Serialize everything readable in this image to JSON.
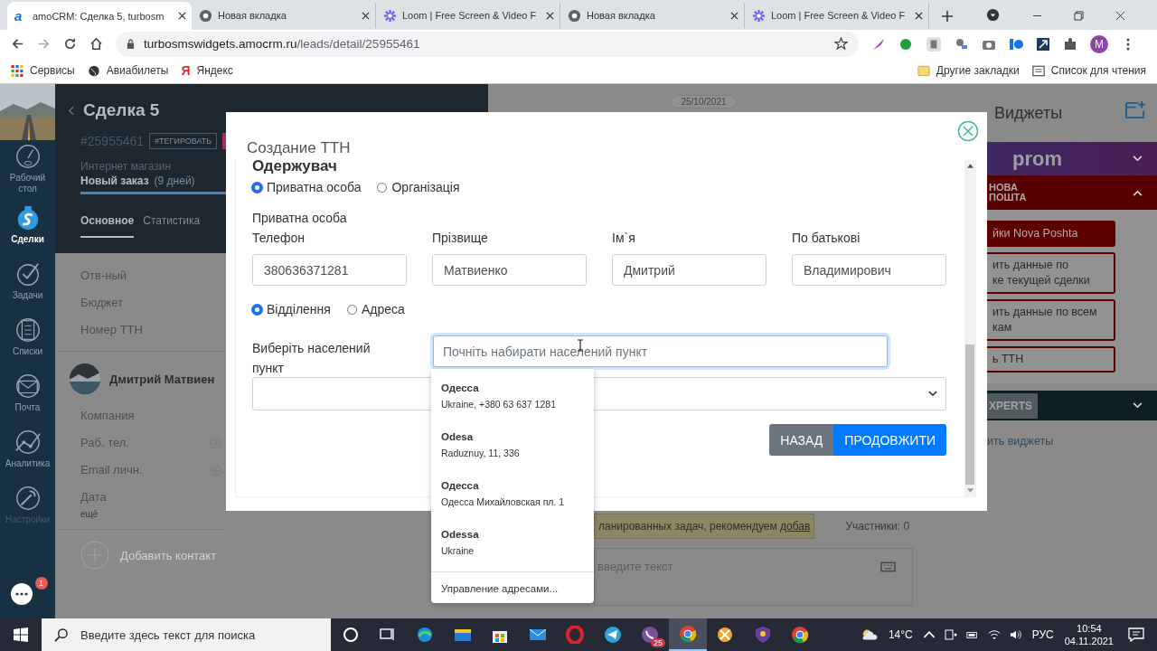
{
  "browser": {
    "tabs": [
      {
        "title": "amoCRM: Сделка 5, turbosm",
        "kind": "amo",
        "glyph": "a",
        "selected": true
      },
      {
        "title": "Новая вкладка",
        "kind": "chrome",
        "selected": false
      },
      {
        "title": "Loom | Free Screen & Video F",
        "kind": "loom",
        "selected": false
      },
      {
        "title": "Новая вкладка",
        "kind": "chrome",
        "selected": false
      },
      {
        "title": "Loom | Free Screen & Video F",
        "kind": "loom",
        "selected": false
      }
    ],
    "url_host": "turbosmswidgets.amocrm.ru",
    "url_path": "/leads/detail/25955461",
    "profile_initial": "M",
    "bookmarks": [
      {
        "label": "Сервисы",
        "kind": "apps"
      },
      {
        "label": "Авиабилеты",
        "kind": "globe"
      },
      {
        "label": "Яндекс",
        "kind": "yandex",
        "glyph": "Я"
      }
    ],
    "bookmarks_right": [
      {
        "label": "Другие закладки",
        "kind": "folder"
      },
      {
        "label": "Список для чтения",
        "kind": "list"
      }
    ]
  },
  "nav": {
    "items": [
      {
        "label": "Рабочий стол",
        "kind": "dashboard",
        "selected": false
      },
      {
        "label": "Сделки",
        "kind": "deals",
        "selected": true
      },
      {
        "label": "Задачи",
        "kind": "tasks",
        "selected": false
      },
      {
        "label": "Списки",
        "kind": "lists",
        "selected": false
      },
      {
        "label": "Почта",
        "kind": "mail",
        "selected": false
      },
      {
        "label": "Аналитика",
        "kind": "analytics",
        "selected": false
      },
      {
        "label": "Настройки",
        "kind": "settings",
        "selected": false
      }
    ],
    "chat_badge": "1"
  },
  "deal": {
    "title": "Сделка 5",
    "id": "#25955461",
    "tag": "#ТЕГИРОВАТЬ",
    "pipeline": "Интернет магазин",
    "stage": "Новый заказ",
    "stage_age": "(9 дней)",
    "level": 0.4,
    "tabs": [
      {
        "label": "Основное",
        "selected": true
      },
      {
        "label": "Статистика",
        "selected": false
      }
    ],
    "fields": [
      "Отв-ный",
      "Бюджет",
      "Номер ТТН"
    ],
    "contact": {
      "name": "Дмитрий Матвиен",
      "fields": [
        {
          "label": "Компания",
          "addable": false
        },
        {
          "label": "Раб. тел.",
          "addable": true
        },
        {
          "label": "Email личн.",
          "addable": true
        },
        {
          "label": "Дата",
          "addable": false
        }
      ],
      "more": "ещё"
    },
    "add_contact": "Добавить контакт"
  },
  "feed": {
    "date": "25/10/2021",
    "notice": "ланированных задач, рекомендуем ",
    "notice_link": "добав",
    "participants": "Участники: 0",
    "composer_placeholder": "введите текст"
  },
  "widgets": {
    "title": "Виджеты",
    "prom_logo": "prom",
    "np_logo": [
      "НОВА",
      "ПОШТА"
    ],
    "np_buttons": [
      {
        "lines": [
          "йки Nova Poshta"
        ],
        "kind": "primary"
      },
      {
        "lines": [
          "ить данные по",
          "ке текущей сделки"
        ],
        "kind": "outline"
      },
      {
        "lines": [
          "ить данные по всем",
          "кам"
        ],
        "kind": "outline"
      },
      {
        "lines": [
          "ь ТТН"
        ],
        "kind": "outline"
      }
    ],
    "experts_logo": "XPERTS",
    "link": "ить виджеты"
  },
  "modal": {
    "title": "Создание ТТН",
    "section": "Одержувач",
    "recipient_types": [
      {
        "label": "Приватна особа",
        "selected": true
      },
      {
        "label": "Організація",
        "selected": false
      }
    ],
    "subheading": "Приватна особа",
    "person_fields": [
      {
        "label": "Телефон",
        "value": "380636371281"
      },
      {
        "label": "Прізвище",
        "value": "Матвиенко"
      },
      {
        "label": "Ім`я",
        "value": "Дмитрий"
      },
      {
        "label": "По батькові",
        "value": "Владимирович"
      }
    ],
    "delivery_types": [
      {
        "label": "Відділення",
        "selected": true
      },
      {
        "label": "Адреса",
        "selected": false
      }
    ],
    "city_label": "Виберіть населений пункт",
    "city_placeholder": "Почніть набирати населений пункт",
    "suggestions": [
      {
        "title": "Одесса",
        "detail": "Ukraine, +380 63 637 1281"
      },
      {
        "title": "Odesa",
        "detail": "Raduznuy, 11, 336"
      },
      {
        "title": "Одесса",
        "detail": "Одесса Михайловская пл. 1"
      },
      {
        "title": "Odessa",
        "detail": "Ukraine"
      }
    ],
    "manage_addresses": "Управление адресами...",
    "buttons": [
      {
        "label": "НАЗАД",
        "kind": "secondary"
      },
      {
        "label": "ПРОДОВЖИТИ",
        "kind": "primary"
      }
    ]
  },
  "taskbar": {
    "search_placeholder": "Введите здесь текст для поиска",
    "apps": [
      {
        "kind": "taskview",
        "selected": false
      },
      {
        "kind": "edge",
        "selected": false
      },
      {
        "kind": "folder",
        "selected": false
      },
      {
        "kind": "store",
        "selected": false
      },
      {
        "kind": "mail",
        "selected": false
      },
      {
        "kind": "opera",
        "selected": false
      },
      {
        "kind": "telegram",
        "selected": false
      },
      {
        "kind": "viber",
        "selected": false,
        "badge": "25"
      },
      {
        "kind": "chrome",
        "selected": true
      },
      {
        "kind": "app",
        "selected": false
      },
      {
        "kind": "shield",
        "selected": false
      },
      {
        "kind": "chrome",
        "selected": false
      }
    ],
    "temperature": "14°C",
    "language": "РУС",
    "time": "10:54",
    "date": "04.11.2021"
  }
}
